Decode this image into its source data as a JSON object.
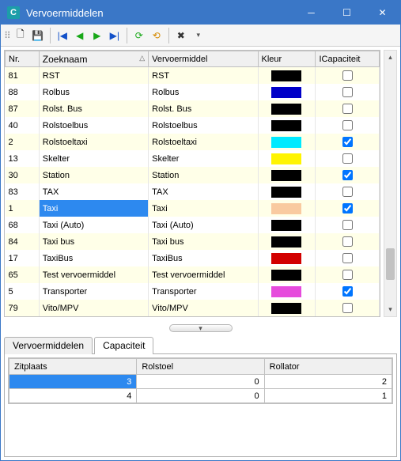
{
  "window": {
    "title": "Vervoermiddelen"
  },
  "grid": {
    "headers": {
      "nr": "Nr.",
      "zoeknaam": "Zoeknaam",
      "vervoermiddel": "Vervoermiddel",
      "kleur": "Kleur",
      "capaciteit": "ICapaciteit"
    },
    "rows": [
      {
        "nr": "81",
        "zoek": "RST",
        "verv": "RST",
        "color": "#000000",
        "cap": false
      },
      {
        "nr": "88",
        "zoek": "Rolbus",
        "verv": "Rolbus",
        "color": "#0000c8",
        "cap": false
      },
      {
        "nr": "87",
        "zoek": "Rolst. Bus",
        "verv": "Rolst. Bus",
        "color": "#000000",
        "cap": false
      },
      {
        "nr": "40",
        "zoek": "Rolstoelbus",
        "verv": "Rolstoelbus",
        "color": "#000000",
        "cap": false
      },
      {
        "nr": "2",
        "zoek": "Rolstoeltaxi",
        "verv": "Rolstoeltaxi",
        "color": "#00eaff",
        "cap": true
      },
      {
        "nr": "13",
        "zoek": "Skelter",
        "verv": "Skelter",
        "color": "#fff400",
        "cap": false
      },
      {
        "nr": "30",
        "zoek": "Station",
        "verv": "Station",
        "color": "#000000",
        "cap": true
      },
      {
        "nr": "83",
        "zoek": "TAX",
        "verv": "TAX",
        "color": "#000000",
        "cap": false
      },
      {
        "nr": "1",
        "zoek": "Taxi",
        "verv": "Taxi",
        "color": "#f9caa0",
        "cap": true,
        "selected": true
      },
      {
        "nr": "68",
        "zoek": "Taxi (Auto)",
        "verv": "Taxi (Auto)",
        "color": "#000000",
        "cap": false
      },
      {
        "nr": "84",
        "zoek": "Taxi bus",
        "verv": "Taxi bus",
        "color": "#000000",
        "cap": false
      },
      {
        "nr": "17",
        "zoek": "TaxiBus",
        "verv": "TaxiBus",
        "color": "#d20000",
        "cap": false
      },
      {
        "nr": "65",
        "zoek": "Test vervoermiddel",
        "verv": "Test vervoermiddel",
        "color": "#000000",
        "cap": false
      },
      {
        "nr": "5",
        "zoek": "Transporter",
        "verv": "Transporter",
        "color": "#e64bdc",
        "cap": true
      },
      {
        "nr": "79",
        "zoek": "Vito/MPV",
        "verv": "Vito/MPV",
        "color": "#000000",
        "cap": false
      }
    ]
  },
  "tabs": {
    "vervoermiddelen": "Vervoermiddelen",
    "capaciteit": "Capaciteit"
  },
  "subgrid": {
    "headers": {
      "zitplaats": "Zitplaats",
      "rolstoel": "Rolstoel",
      "rollator": "Rollator"
    },
    "rows": [
      {
        "zit": "3",
        "rol": "0",
        "rla": "2",
        "selected": true
      },
      {
        "zit": "4",
        "rol": "0",
        "rla": "1"
      }
    ]
  }
}
